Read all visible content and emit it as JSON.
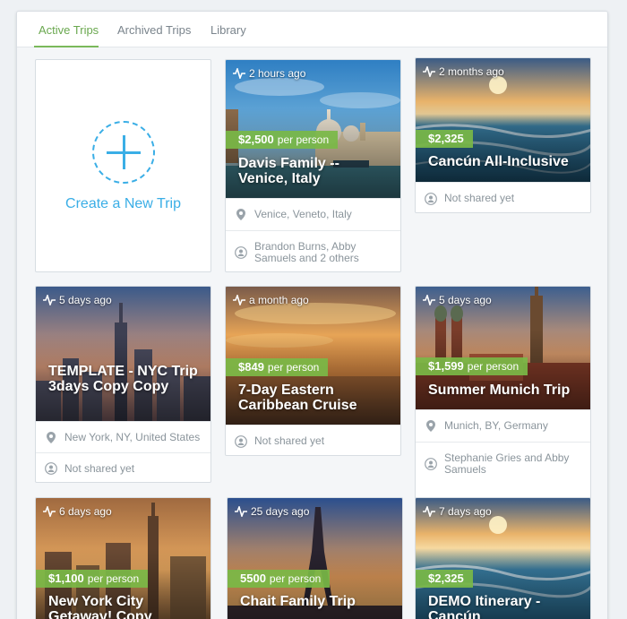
{
  "tabs": [
    {
      "label": "Active Trips",
      "active": true
    },
    {
      "label": "Archived Trips",
      "active": false
    },
    {
      "label": "Library",
      "active": false
    }
  ],
  "create": {
    "label": "Create a New Trip"
  },
  "trips": [
    {
      "ago": "2 hours ago",
      "price": "$2,500",
      "per_person": "per person",
      "title": "Davis Family -- Venice, Italy",
      "location": "Venice, Veneto, Italy",
      "shared": "Brandon Burns, Abby Samuels and 2 others",
      "image": "venice"
    },
    {
      "ago": "2 months ago",
      "price": "$2,325",
      "per_person": "",
      "title": "Cancún All-Inclusive",
      "location": "",
      "shared": "Not shared yet",
      "image": "beach"
    },
    {
      "ago": "5 days ago",
      "price": "",
      "per_person": "",
      "title": "TEMPLATE - NYC Trip 3days Copy Copy",
      "location": "New York, NY, United States",
      "shared": "Not shared yet",
      "image": "nyc"
    },
    {
      "ago": "a month ago",
      "price": "$849",
      "per_person": "per person",
      "title": "7-Day Eastern Caribbean Cruise",
      "location": "",
      "shared": "Not shared yet",
      "image": "sunset"
    },
    {
      "ago": "5 days ago",
      "price": "$1,599",
      "per_person": "per person",
      "title": "Summer Munich Trip",
      "location": "Munich, BY, Germany",
      "shared": "Stephanie Gries and Abby Samuels",
      "image": "munich"
    },
    {
      "ago": "6 days ago",
      "price": "$1,100",
      "per_person": "per person",
      "title": "New York City Getaway! Copy",
      "location": "",
      "shared": "",
      "image": "nycsunset"
    },
    {
      "ago": "25 days ago",
      "price": "5500",
      "per_person": "per person",
      "title": "Chait Family Trip",
      "location": "",
      "shared": "",
      "image": "paris"
    },
    {
      "ago": "7 days ago",
      "price": "$2,325",
      "per_person": "",
      "title": "DEMO Itinerary - Cancún",
      "location": "",
      "shared": "",
      "image": "beach"
    }
  ],
  "colors": {
    "accent": "#7ab846",
    "link": "#3aaee6",
    "tab_active": "#6aa84f"
  },
  "icons": {
    "activity": "activity-icon",
    "location": "location-pin-icon",
    "shared": "person-icon",
    "create": "plus-icon"
  }
}
